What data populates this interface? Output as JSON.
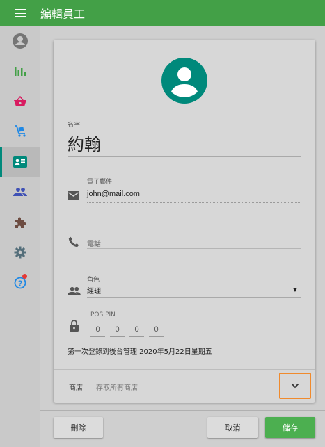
{
  "appbar": {
    "title": "編輯員工",
    "menu_icon": "menu-icon",
    "color": "#43a047"
  },
  "sidebar": {
    "items": [
      {
        "name": "account-circle-icon",
        "color": "#757575",
        "active": false
      },
      {
        "name": "bar-chart-icon",
        "color": "#43a047",
        "active": false
      },
      {
        "name": "shopping-basket-icon",
        "color": "#d81b60",
        "active": false
      },
      {
        "name": "cart-icon",
        "color": "#1e88e5",
        "active": false
      },
      {
        "name": "contact-card-icon",
        "color": "#00897b",
        "active": true
      },
      {
        "name": "people-icon",
        "color": "#3f51b5",
        "active": false
      },
      {
        "name": "puzzle-icon",
        "color": "#6d4c41",
        "active": false
      },
      {
        "name": "gear-icon",
        "color": "#546e7a",
        "active": false
      },
      {
        "name": "help-icon",
        "color": "#1e88e5",
        "active": false,
        "badge": true
      }
    ]
  },
  "form": {
    "name_label": "名字",
    "name_value": "約翰",
    "email_label": "電子郵件",
    "email_value": "john@mail.com",
    "phone_placeholder": "電話",
    "role_label": "角色",
    "role_value": "經理",
    "pos_pin_label": "POS PIN",
    "pin_digits": [
      "0",
      "0",
      "0",
      "0"
    ],
    "login_text": "第一次登錄到後台管理 2020年5月22日星期五",
    "store_label": "商店",
    "store_value": "存取所有商店"
  },
  "actions": {
    "delete": "刪除",
    "cancel": "取消",
    "save": "儲存"
  },
  "colors": {
    "accent": "#00897b",
    "save": "#4caf50",
    "highlight": "#f08a2c"
  }
}
